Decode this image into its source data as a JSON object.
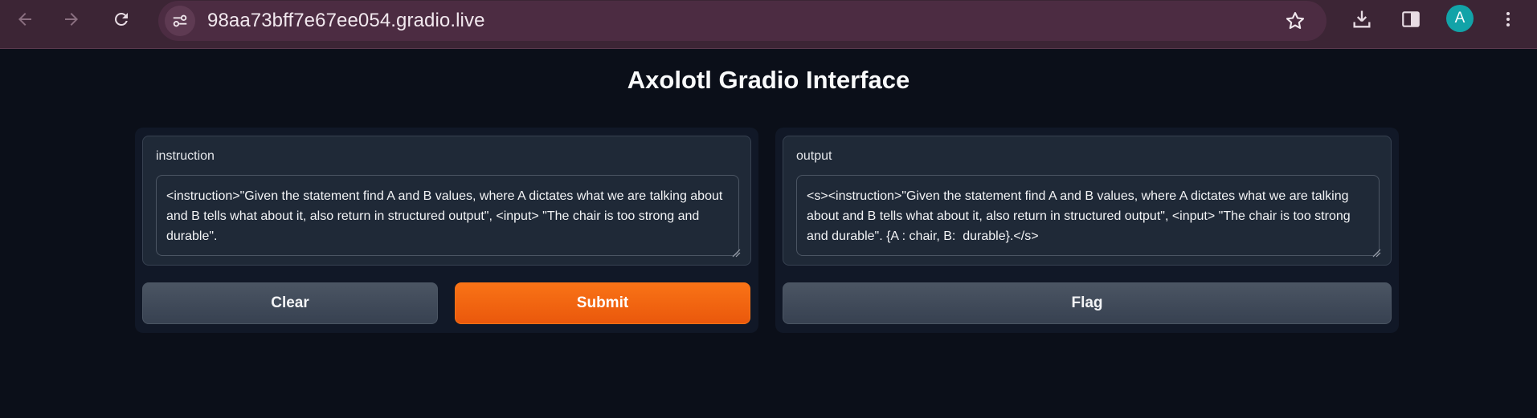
{
  "browser": {
    "url": "98aa73bff7e67ee054.gradio.live",
    "avatar_letter": "A",
    "icons": [
      "back-arrow-icon",
      "forward-arrow-icon",
      "reload-icon",
      "site-settings-icon",
      "bookmark-star-icon",
      "download-icon",
      "side-panel-icon",
      "more-vert-icon"
    ]
  },
  "page": {
    "title": "Axolotl Gradio Interface"
  },
  "input_panel": {
    "label": "instruction",
    "value": "<instruction>\"Given the statement find A and B values, where A dictates what we are talking about and B tells what about it, also return in structured output\", <input> \"The chair is too strong and durable\".",
    "clear_label": "Clear",
    "submit_label": "Submit"
  },
  "output_panel": {
    "label": "output",
    "value": "<s><instruction>\"Given the statement find A and B values, where A dictates what we are talking about and B tells what about it, also return in structured output\", <input> \"The chair is too strong and durable\". {A : chair, B:  durable}.</s>",
    "flag_label": "Flag"
  },
  "colors": {
    "background": "#0b0f19",
    "panel": "#111827",
    "block": "#1f2937",
    "primary": "#f97316",
    "secondary": "#4b5563",
    "browser_chrome": "#3c2535"
  }
}
